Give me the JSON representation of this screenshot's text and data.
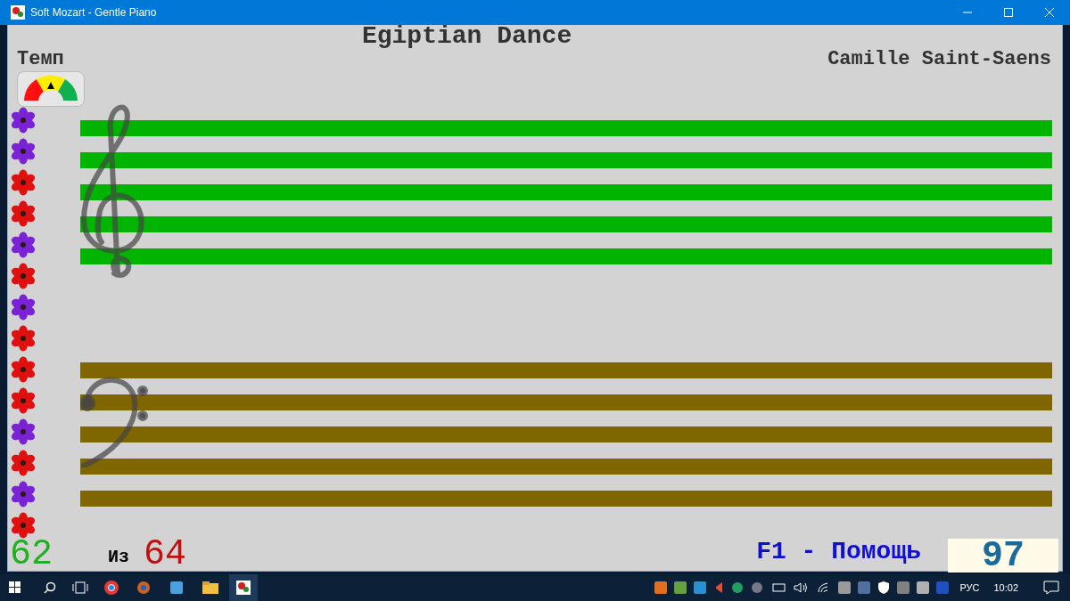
{
  "window": {
    "title": "Soft Mozart - Gentle Piano"
  },
  "piece": {
    "title": "Egiptian Dance",
    "composer": "Camille Saint-Saens"
  },
  "tempo": {
    "label": "Темп",
    "level": 0.5
  },
  "flowers": [
    {
      "color": "#7a22d6"
    },
    {
      "color": "#7a22d6"
    },
    {
      "color": "#e01010"
    },
    {
      "color": "#e01010"
    },
    {
      "color": "#7a22d6"
    },
    {
      "color": "#e01010"
    },
    {
      "color": "#7a22d6"
    },
    {
      "color": "#e01010"
    },
    {
      "color": "#e01010"
    },
    {
      "color": "#e01010"
    },
    {
      "color": "#7a22d6"
    },
    {
      "color": "#e01010"
    },
    {
      "color": "#7a22d6"
    },
    {
      "color": "#e01010"
    }
  ],
  "staves": [
    {
      "kind": "treble",
      "color": "#00b400"
    },
    {
      "kind": "bass",
      "color": "#806600"
    }
  ],
  "footer": {
    "current": "62",
    "of_label": "Из",
    "total": "64",
    "help": "F1 - Помощь",
    "score": "97"
  },
  "taskbar": {
    "language": "РУС",
    "time": "10:02"
  }
}
